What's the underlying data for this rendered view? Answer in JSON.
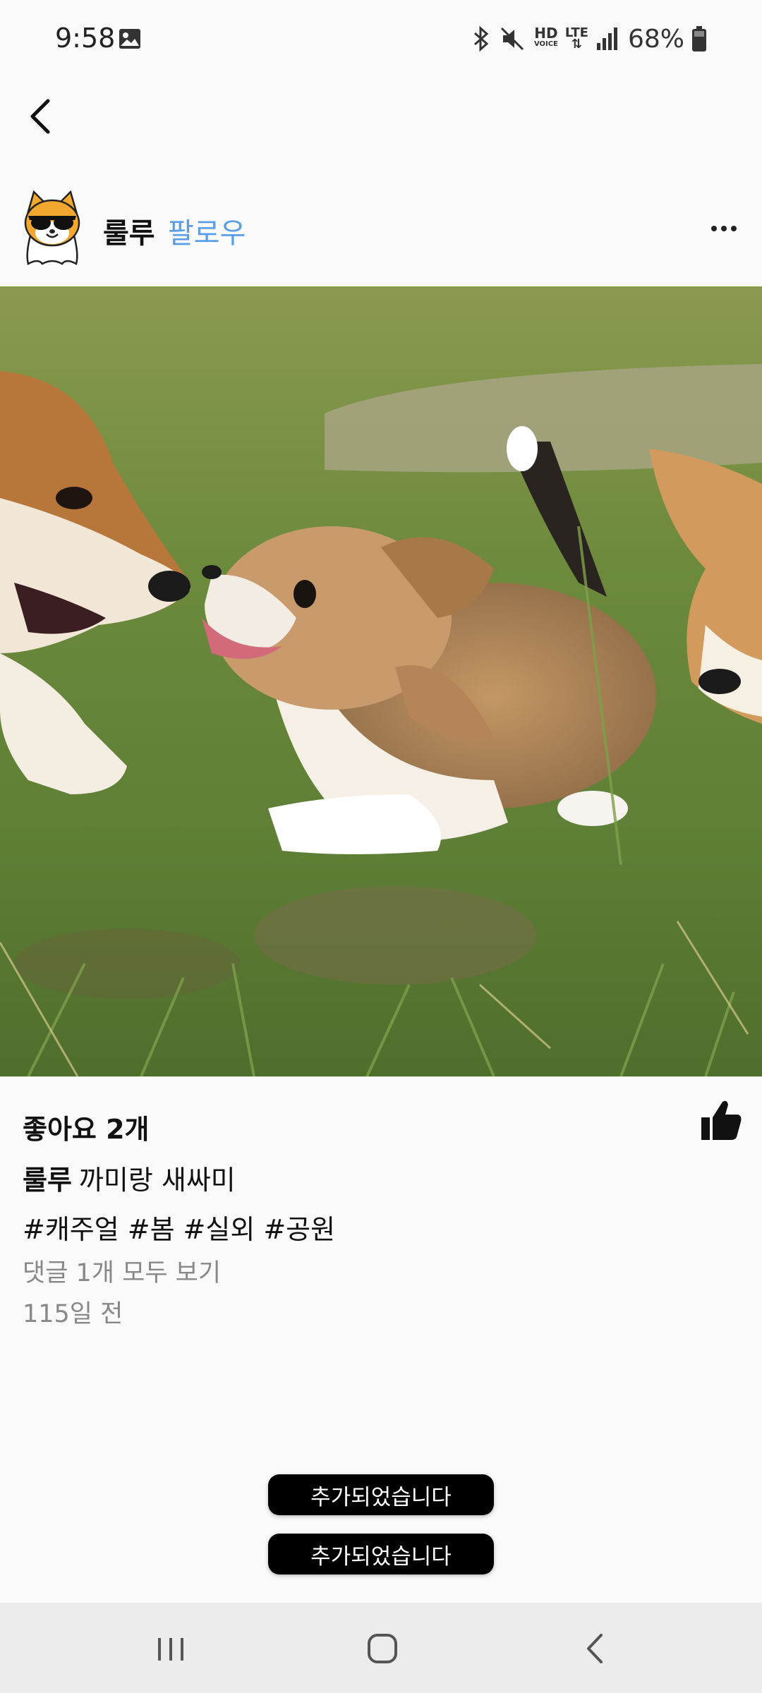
{
  "status_bar": {
    "time": "9:58",
    "icons": [
      "gallery-icon",
      "bluetooth-icon",
      "mute-icon",
      "hd-voice-icon",
      "lte-icon",
      "signal-icon",
      "battery-icon"
    ],
    "hd_label": "HD",
    "hd_sub": "VOICE",
    "lte_label": "LTE",
    "battery": "68%"
  },
  "post": {
    "username": "룰루",
    "follow_label": "팔로우",
    "image_subject": "corgi puppies",
    "likes": "좋아요 2개",
    "caption_user": "룰루",
    "caption_text": "까미랑 새싸미",
    "hashtags": [
      "#캐주얼",
      "#봄",
      "#실외",
      "#공원"
    ],
    "view_comments": "댓글 1개 모두 보기",
    "time_ago": "115일 전"
  },
  "toasts": [
    "추가되었습니다",
    "추가되었습니다"
  ],
  "colors": {
    "follow": "#5a9ee8",
    "background": "#fafafa",
    "secondary_text": "#888888",
    "toast_bg": "#000000"
  }
}
